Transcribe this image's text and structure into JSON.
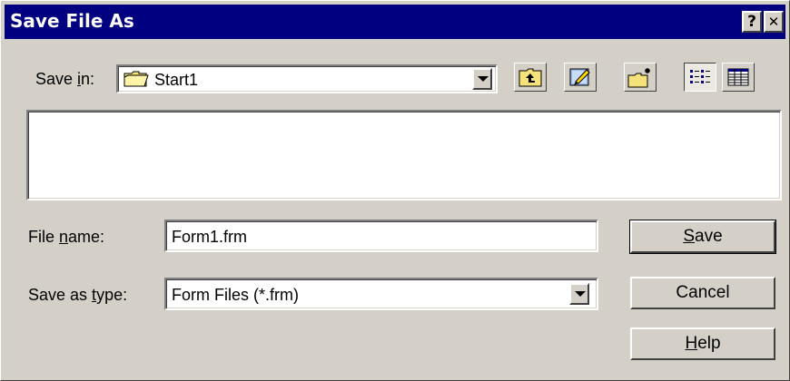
{
  "window": {
    "title": "Save File As",
    "help_glyph": "?",
    "close_glyph": "✕"
  },
  "save_in": {
    "label_pre": "Save ",
    "label_mnemonic": "i",
    "label_post": "n:",
    "value": "Start1",
    "icon": "folder-icon"
  },
  "toolbar": {
    "buttons": [
      {
        "name": "up-one-level",
        "icon": "up-folder-icon"
      },
      {
        "name": "desktop",
        "icon": "desktop-icon"
      },
      {
        "name": "new-folder",
        "icon": "new-folder-icon"
      },
      {
        "name": "list-view",
        "icon": "list-view-icon",
        "pressed": true
      },
      {
        "name": "details-view",
        "icon": "details-view-icon",
        "pressed": false
      }
    ]
  },
  "file_name": {
    "label_pre": "File ",
    "label_mnemonic": "n",
    "label_post": "ame:",
    "value": "Form1.frm"
  },
  "save_as_type": {
    "label_pre": "Save as ",
    "label_mnemonic": "t",
    "label_post": "ype:",
    "value": "Form Files (*.frm)"
  },
  "buttons": {
    "save_mnemonic": "S",
    "save_rest": "ave",
    "cancel": "Cancel",
    "help_mnemonic": "H",
    "help_rest": "elp"
  },
  "colors": {
    "titlebar": "#000080",
    "face": "#d4d0c8",
    "window": "#ffffff"
  }
}
